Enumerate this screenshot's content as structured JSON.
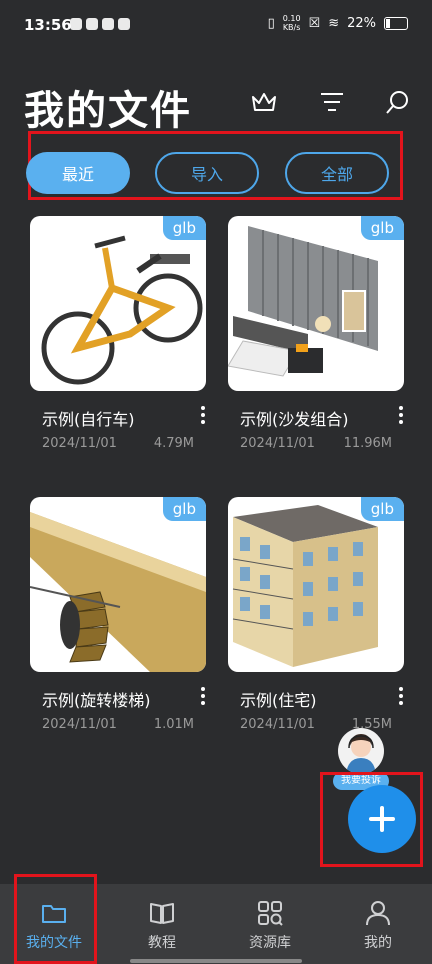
{
  "status_bar": {
    "time": "13:56",
    "net_speed_top": "0.10",
    "net_speed_bottom": "KB/s",
    "battery": "22%"
  },
  "header": {
    "title": "我的文件",
    "icons": [
      "vip-crown-icon",
      "filter-icon",
      "search-icon"
    ]
  },
  "tabs": [
    {
      "label": "最近",
      "selected": true
    },
    {
      "label": "导入",
      "selected": false
    },
    {
      "label": "全部",
      "selected": false
    }
  ],
  "files": [
    {
      "name": "示例(自行车)",
      "date": "2024/11/01",
      "size": "4.79M",
      "badge": "glb"
    },
    {
      "name": "示例(沙发组合)",
      "date": "2024/11/01",
      "size": "11.96M",
      "badge": "glb"
    },
    {
      "name": "示例(旋转楼梯)",
      "date": "2024/11/01",
      "size": "1.01M",
      "badge": "glb"
    },
    {
      "name": "示例(住宅)",
      "date": "2024/11/01",
      "size": "1.55M",
      "badge": "glb"
    }
  ],
  "support": {
    "label": "我要投诉"
  },
  "bottom_nav": [
    {
      "label": "我的文件",
      "icon": "folder-icon",
      "active": true
    },
    {
      "label": "教程",
      "icon": "book-icon",
      "active": false
    },
    {
      "label": "资源库",
      "icon": "grid-icon",
      "active": false
    },
    {
      "label": "我的",
      "icon": "user-icon",
      "active": false
    }
  ],
  "colors": {
    "background": "#2b2c2e",
    "accent": "#5ab0ef",
    "fab": "#1f8fea",
    "highlight": "#e2141c"
  }
}
